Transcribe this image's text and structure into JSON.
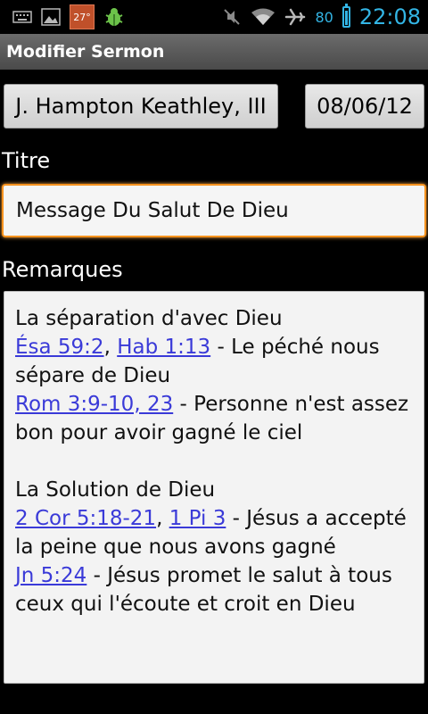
{
  "status_bar": {
    "temperature": "27°",
    "battery": "80",
    "time": "22:08",
    "icons": [
      "keyboard-icon",
      "image-icon",
      "weather-icon",
      "bug-icon",
      "mute-icon",
      "wifi-icon",
      "airplane-icon",
      "battery-icon"
    ]
  },
  "app": {
    "title": "Modifier Sermon"
  },
  "form": {
    "author_button": "J. Hampton Keathley, III",
    "date_button": "08/06/12",
    "title_label": "Titre",
    "title_value": "Message Du Salut De Dieu",
    "remarks_label": "Remarques"
  },
  "notes": {
    "l1": "La séparation d'avec Dieu",
    "link1": "Ésa 59:2",
    "sep1": ", ",
    "link2": "Hab 1:13",
    "text2": " - Le péché nous sépare de Dieu",
    "link3": "Rom 3:9-10, 23",
    "text3": " - Personne n'est assez bon pour avoir gagné le ciel",
    "l4": "La Solution de Dieu",
    "link4": "2 Cor 5:18-21",
    "sep4": ", ",
    "link5": "1 Pi 3",
    "text5": " - Jésus a accepté la peine que nous avons gagné",
    "link6": "Jn 5:24",
    "text6": " - Jésus promet le salut à tous ceux qui l'écoute et croit en Dieu"
  },
  "colors": {
    "accent": "#33b5e5",
    "focus_border": "#f7931e",
    "link": "#3a3ad8"
  }
}
